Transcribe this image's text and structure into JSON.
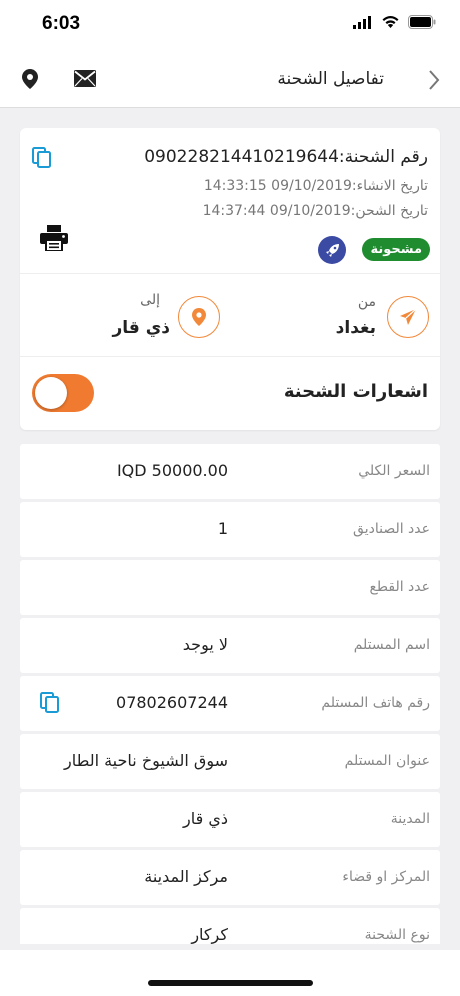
{
  "status_bar": {
    "time": "6:03"
  },
  "nav": {
    "title": "تفاصيل الشحنة"
  },
  "shipment": {
    "number": "رقم الشحنة:090228214410219644",
    "created": "تاريخ الانشاء:09/10/2019 14:33:15",
    "shipped": "تاريخ الشحن:09/10/2019 14:37:44",
    "status": "مشحونة",
    "status_color": "#1e8c2f",
    "from_label": "من",
    "from_city": "بغداد",
    "to_label": "إلى",
    "to_city": "ذي قار",
    "notifications_label": "اشعارات الشحنة",
    "notifications_enabled": true,
    "accent_color": "#f07b30"
  },
  "details": [
    {
      "label": "السعر الكلي",
      "value": "IQD 50000.00"
    },
    {
      "label": "عدد الصناديق",
      "value": "1"
    },
    {
      "label": "عدد القطع",
      "value": ""
    },
    {
      "label": "اسم المستلم",
      "value": "لا يوجد"
    },
    {
      "label": "رقم هاتف المستلم",
      "value": "07802607244"
    },
    {
      "label": "عنوان المستلم",
      "value": "سوق الشيوخ ناحية الطار"
    },
    {
      "label": "المدينة",
      "value": "ذي قار"
    },
    {
      "label": "المركز او قضاء",
      "value": "مركز المدينة"
    },
    {
      "label": "نوع الشحنة",
      "value": "كركار"
    }
  ]
}
